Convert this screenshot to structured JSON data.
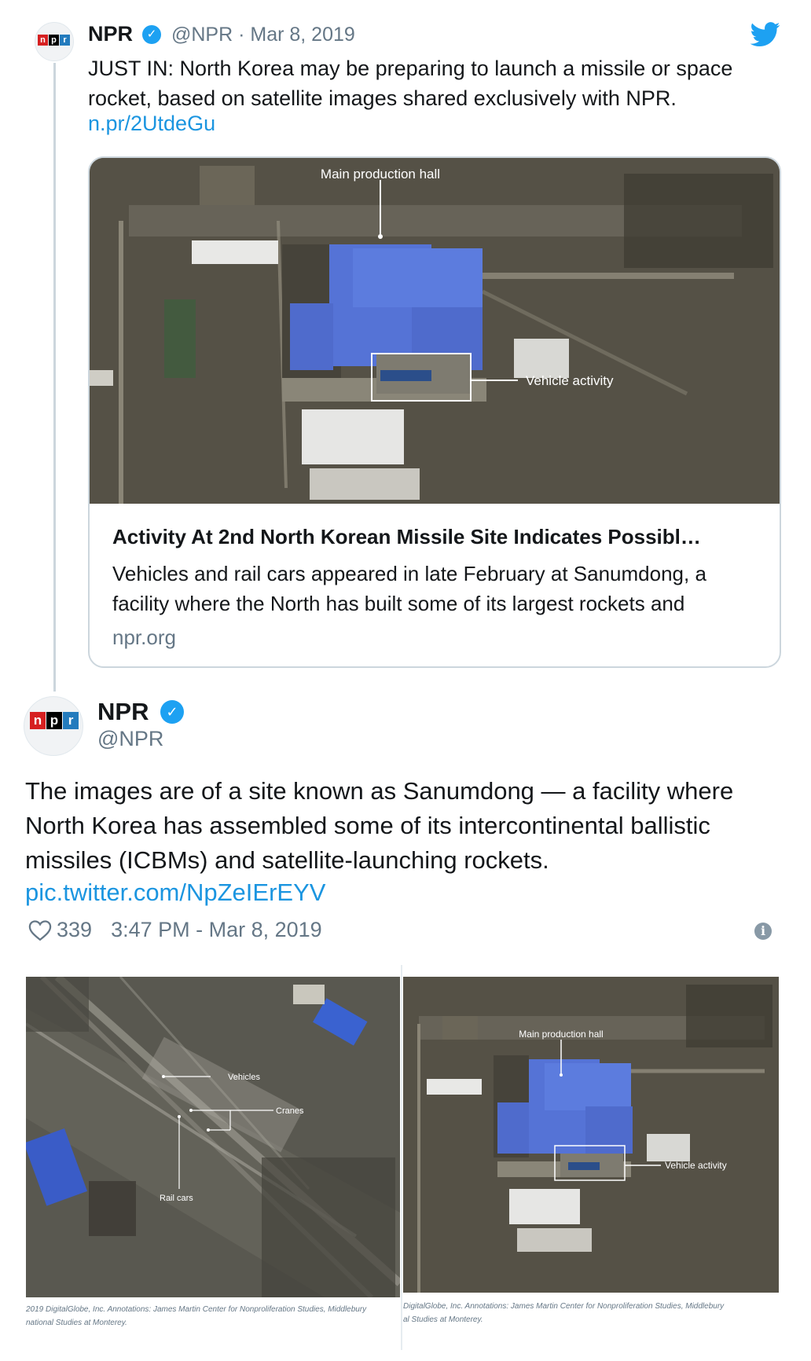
{
  "parent_tweet": {
    "avatar_logo": [
      "n",
      "p",
      "r"
    ],
    "name": "NPR",
    "handle_date": "@NPR · Mar 8, 2019",
    "text": "JUST IN: North Korea may be preparing to launch a missile or space rocket, based on satellite images shared exclusively with NPR.",
    "link": "n.pr/2UtdeGu",
    "card": {
      "image_labels": {
        "main_hall": "Main production hall",
        "vehicle": "Vehicle activity"
      },
      "title": "Activity At 2nd North Korean Missile Site Indicates Possibl…",
      "description": "Vehicles and rail cars appeared in late February at Sanumdong, a facility where the North has built some of its largest rockets and",
      "domain": "npr.org"
    }
  },
  "main_tweet": {
    "avatar_logo": [
      "n",
      "p",
      "r"
    ],
    "name": "NPR",
    "handle": "@NPR",
    "text": "The images are of a site known as Sanumdong — a facility where North Korea has assembled some of its intercontinental ballistic missiles (ICBMs) and satellite-launching rockets.",
    "link": "pic.twitter.com/NpZeIErEYV",
    "likes": "339",
    "timestamp": "3:47 PM - Mar 8, 2019",
    "media": {
      "left_labels": {
        "vehicles": "Vehicles",
        "cranes": "Cranes",
        "rail_cars": "Rail cars"
      },
      "left_credit_1": "2019 DigitalGlobe, Inc. Annotations: James Martin Center for Nonproliferation Studies, Middlebury",
      "left_credit_2": "national Studies at Monterey.",
      "right_labels": {
        "main_hall": "Main production hall",
        "vehicle": "Vehicle activity"
      },
      "right_credit_1": "DigitalGlobe, Inc. Annotations: James Martin Center for Nonproliferation Studies, Middlebury",
      "right_credit_2": "al Studies at Monterey."
    }
  },
  "icons": {
    "bird": "twitter-bird-icon",
    "verified": "verified-badge-icon",
    "heart": "heart-icon",
    "info": "info-icon"
  },
  "colors": {
    "link": "#1b95e0",
    "muted": "#657786",
    "verified": "#1da1f2",
    "npr_red": "#d62021",
    "npr_black": "#000000",
    "npr_blue": "#237bbd"
  }
}
